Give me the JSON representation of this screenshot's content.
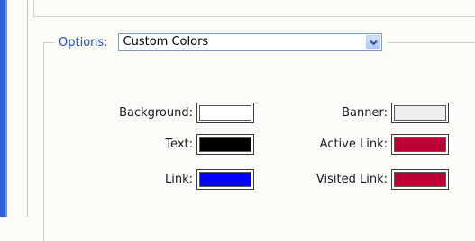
{
  "options": {
    "label": "Options:",
    "selected": "Custom Colors"
  },
  "colors": {
    "background": {
      "label": "Background:",
      "color": "#ffffff"
    },
    "text": {
      "label": "Text:",
      "color": "#000000"
    },
    "link": {
      "label": "Link:",
      "color": "#0000ff"
    },
    "banner": {
      "label": "Banner:",
      "color": "#eeeeee"
    },
    "active_link": {
      "label": "Active Link:",
      "color": "#bd0034"
    },
    "visited_link": {
      "label": "Visited Link:",
      "color": "#bd0034"
    }
  }
}
